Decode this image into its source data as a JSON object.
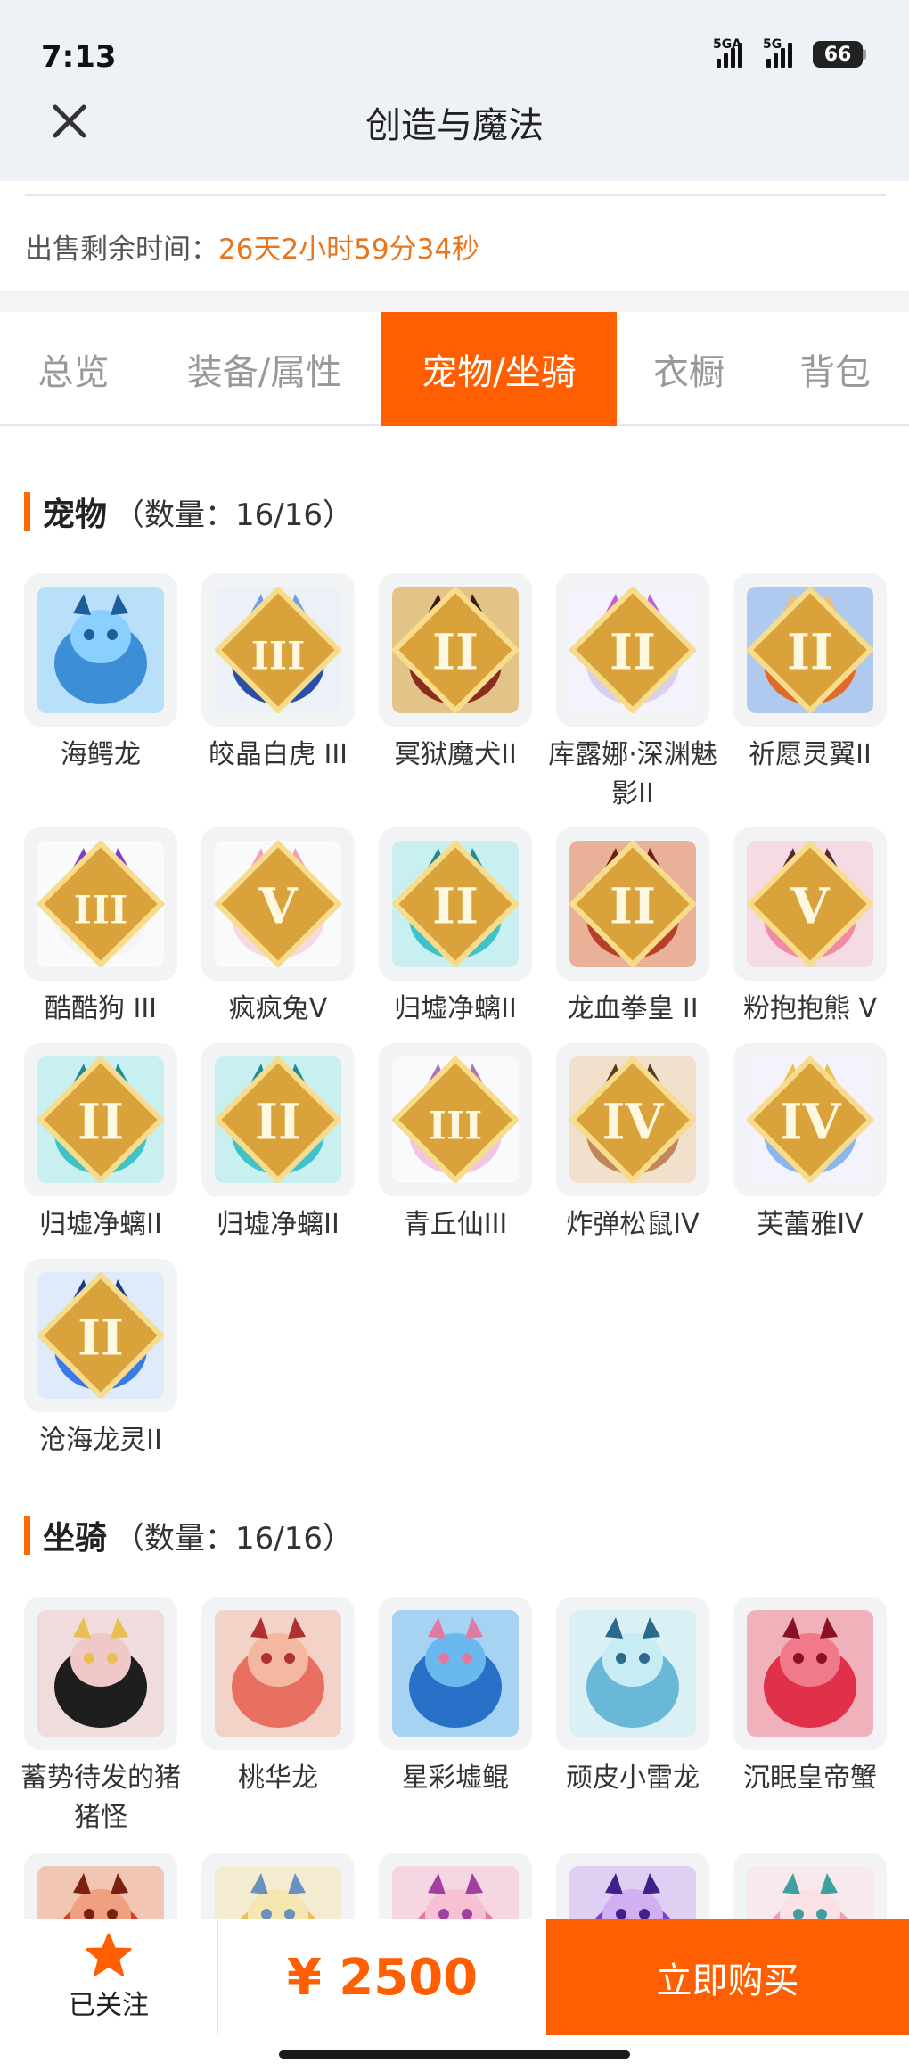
{
  "status": {
    "time": "7:13",
    "signal1": "5GA",
    "signal2": "5G",
    "battery": "66"
  },
  "header": {
    "title": "创造与魔法"
  },
  "sale": {
    "label": "出售剩余时间：",
    "value": "26天2小时59分34秒"
  },
  "tabs": [
    {
      "label": "总览"
    },
    {
      "label": "装备/属性"
    },
    {
      "label": "宠物/坐骑",
      "active": true
    },
    {
      "label": "衣橱"
    },
    {
      "label": "背包"
    }
  ],
  "pets": {
    "title": "宠物",
    "count": "（数量：16/16）",
    "items": [
      {
        "name": "海鳄龙",
        "icon": "blue-dragon-icon",
        "badge": ""
      },
      {
        "name": "皎晶白虎 III",
        "icon": "white-tiger-icon",
        "badge": "III"
      },
      {
        "name": "冥狱魔犬II",
        "icon": "hell-hound-icon",
        "badge": "II"
      },
      {
        "name": "库露娜·深渊魅影II",
        "icon": "abyss-girl-icon",
        "badge": "II"
      },
      {
        "name": "祈愿灵翼II",
        "icon": "wing-bird-icon",
        "badge": "II"
      },
      {
        "name": "酷酷狗 III",
        "icon": "cool-dog-icon",
        "badge": "III"
      },
      {
        "name": "疯疯兔V",
        "icon": "crazy-rabbit-icon",
        "badge": "V"
      },
      {
        "name": "归墟净螭II",
        "icon": "teal-dragon-icon",
        "badge": "II"
      },
      {
        "name": "龙血拳皇 II",
        "icon": "red-beast-icon",
        "badge": "II"
      },
      {
        "name": "粉抱抱熊 V",
        "icon": "pink-bear-icon",
        "badge": "V"
      },
      {
        "name": "归墟净螭II",
        "icon": "teal-dragon-icon",
        "badge": "II"
      },
      {
        "name": "归墟净螭II",
        "icon": "teal-dragon-icon",
        "badge": "II"
      },
      {
        "name": "青丘仙III",
        "icon": "fox-fairy-icon",
        "badge": "III"
      },
      {
        "name": "炸弹松鼠IV",
        "icon": "bomb-squirrel-icon",
        "badge": "IV"
      },
      {
        "name": "芙蕾雅IV",
        "icon": "freya-icon",
        "badge": "IV"
      },
      {
        "name": "沧海龙灵II",
        "icon": "sea-dragon-spirit-icon",
        "badge": "II"
      }
    ]
  },
  "mounts": {
    "title": "坐骑",
    "count": "（数量：16/16）",
    "items": [
      {
        "name": "蓄势待发的猪猪怪",
        "icon": "black-pig-icon"
      },
      {
        "name": "桃华龙",
        "icon": "peach-dragon-icon"
      },
      {
        "name": "星彩墟鲲",
        "icon": "star-whale-icon"
      },
      {
        "name": "顽皮小雷龙",
        "icon": "thunder-dragon-icon"
      },
      {
        "name": "沉眠皇帝蟹",
        "icon": "emperor-crab-icon"
      },
      {
        "name": "",
        "icon": "red-mount-icon"
      },
      {
        "name": "",
        "icon": "gold-mount-icon"
      },
      {
        "name": "",
        "icon": "pink-mount-icon"
      },
      {
        "name": "",
        "icon": "purple-mount-icon"
      },
      {
        "name": "",
        "icon": "lion-dance-icon"
      }
    ]
  },
  "bottom": {
    "follow_label": "已关注",
    "price": "¥ 2500",
    "buy_label": "立即购买"
  },
  "colors": {
    "accent": "#ff5f00",
    "time_value": "#e8741b",
    "section_mark": "#ff6a00"
  }
}
